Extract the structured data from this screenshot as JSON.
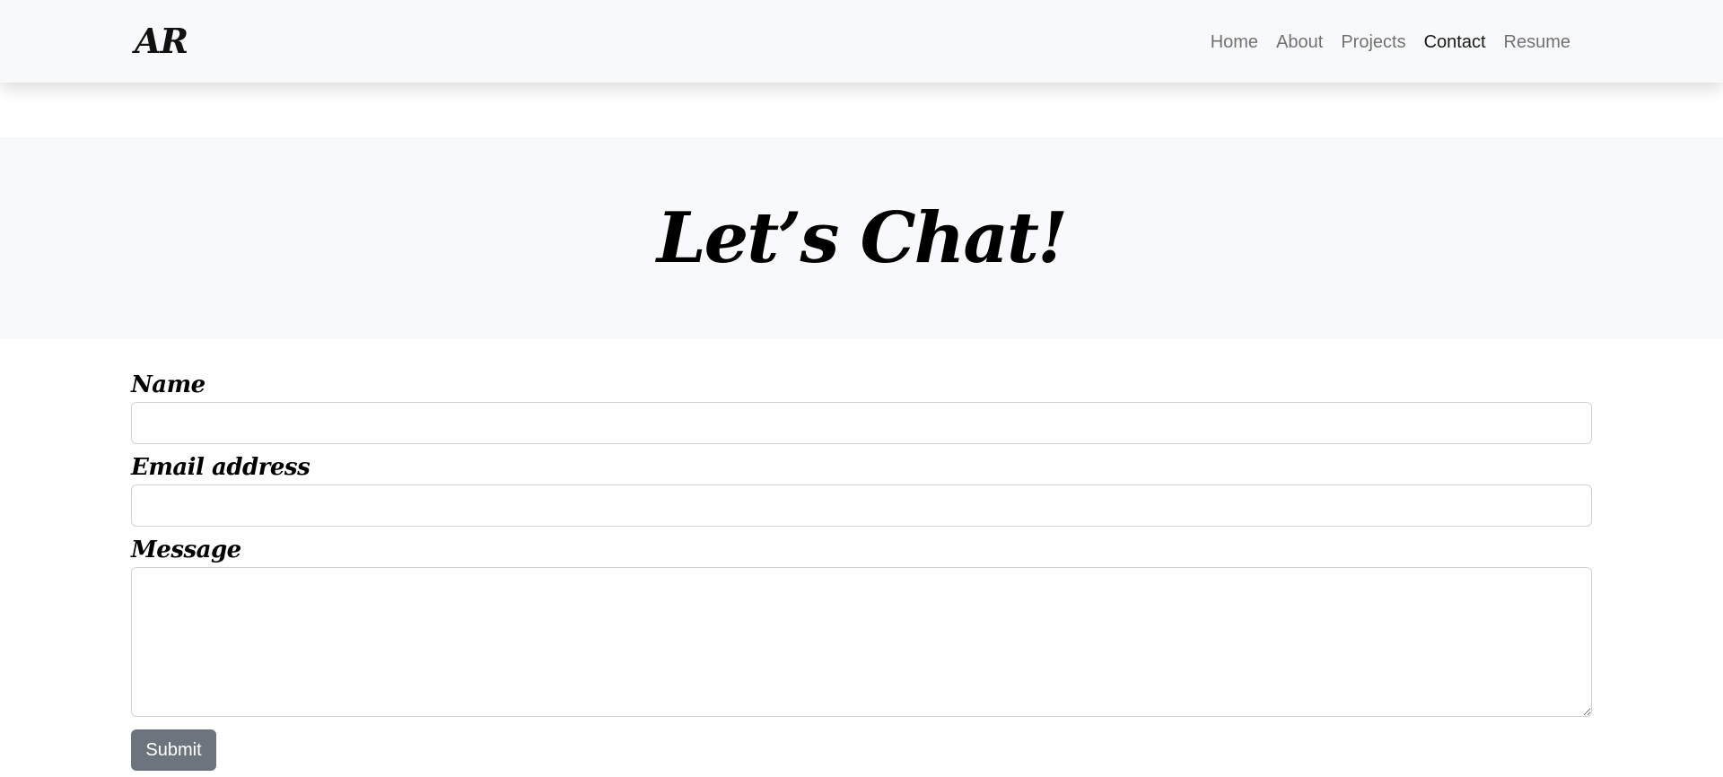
{
  "navbar": {
    "brand": "AR",
    "links": [
      {
        "label": "Home",
        "active": false
      },
      {
        "label": "About",
        "active": false
      },
      {
        "label": "Projects",
        "active": false
      },
      {
        "label": "Contact",
        "active": true
      },
      {
        "label": "Resume",
        "active": false
      }
    ]
  },
  "hero": {
    "title": "Let’s Chat!"
  },
  "form": {
    "name_label": "Name",
    "name_value": "",
    "email_label": "Email address",
    "email_value": "",
    "message_label": "Message",
    "message_value": "",
    "submit_label": "Submit"
  },
  "colors": {
    "navbar_bg": "#f8f9fa",
    "hero_bg": "#f8f9fa",
    "button_bg": "#6c757d"
  }
}
